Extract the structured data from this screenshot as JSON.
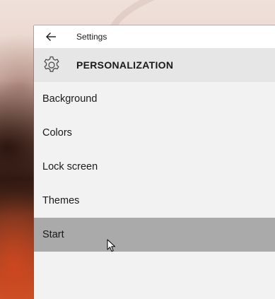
{
  "window": {
    "title": "Settings"
  },
  "header": {
    "title": "PERSONALIZATION",
    "icon": "gear-icon"
  },
  "nav": {
    "items": [
      {
        "label": "Background",
        "selected": false
      },
      {
        "label": "Colors",
        "selected": false
      },
      {
        "label": "Lock screen",
        "selected": false
      },
      {
        "label": "Themes",
        "selected": false
      },
      {
        "label": "Start",
        "selected": true
      }
    ]
  },
  "colors": {
    "window_background": "#f2f2f2",
    "header_background": "#e6e6e6",
    "selected_item": "#aaaaaa",
    "text": "#1a1a1a"
  }
}
